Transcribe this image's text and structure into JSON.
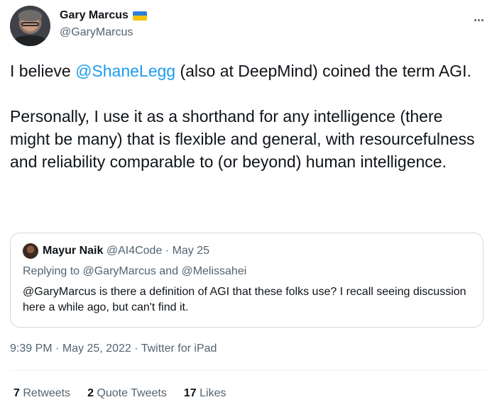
{
  "author": {
    "display_name": "Gary Marcus",
    "handle": "@GaryMarcus",
    "flag_icon": "ukraine-flag-icon"
  },
  "tweet": {
    "para1_prefix": "I believe ",
    "para1_mention": "@ShaneLegg",
    "para1_suffix": " (also at DeepMind) coined the term AGI.",
    "para2": "Personally, I use it as a shorthand for any intelligence (there might be many) that is flexible and general, with resourcefulness and reliability comparable to (or beyond) human intelligence."
  },
  "quote": {
    "display_name": "Mayur Naik",
    "handle": "@AI4Code",
    "separator": " · ",
    "date": "May 25",
    "replying_to": "Replying to @GaryMarcus and @Melissahei",
    "text": "@GaryMarcus is there a definition of AGI that these folks use? I recall seeing discussion here a while ago, but can't find it."
  },
  "meta": {
    "time": "9:39 PM",
    "date": "May 25, 2022",
    "source": "Twitter for iPad",
    "sep": " · "
  },
  "stats": {
    "retweets_count": "7",
    "retweets_label": "Retweets",
    "quotes_count": "2",
    "quotes_label": "Quote Tweets",
    "likes_count": "17",
    "likes_label": "Likes"
  },
  "colors": {
    "link": "#1d9bf0",
    "secondary_text": "#536471",
    "border": "#cfd9de"
  }
}
